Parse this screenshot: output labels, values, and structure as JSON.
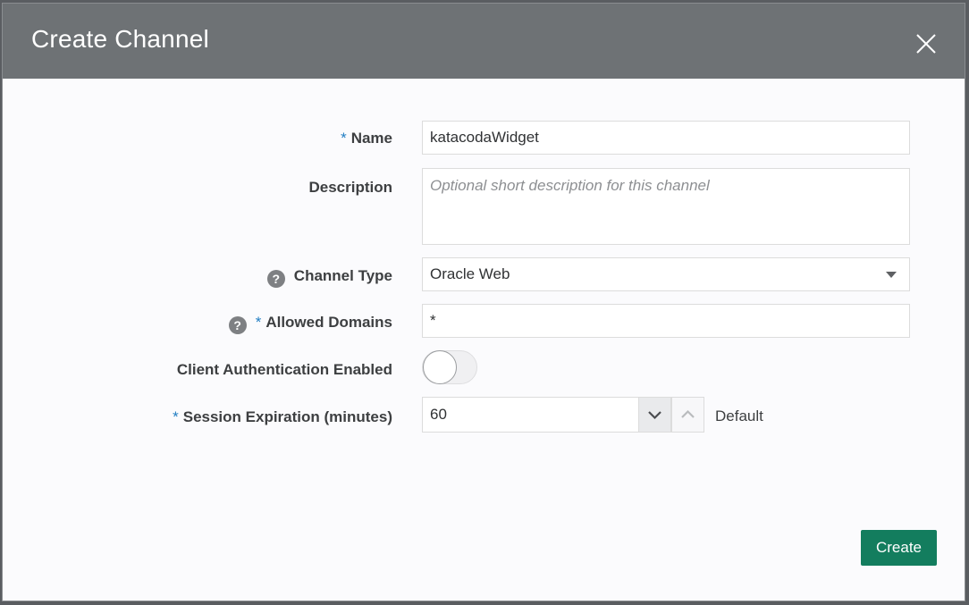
{
  "dialog": {
    "title": "Create Channel",
    "close_icon": "close-icon"
  },
  "form": {
    "name": {
      "required_mark": "*",
      "label": "Name",
      "value": "katacodaWidget"
    },
    "description": {
      "label": "Description",
      "value": "",
      "placeholder": "Optional short description for this channel"
    },
    "channel_type": {
      "help_icon": "?",
      "label": "Channel Type",
      "value": "Oracle Web"
    },
    "allowed_domains": {
      "help_icon": "?",
      "required_mark": "*",
      "label": "Allowed Domains",
      "value": "*"
    },
    "client_auth": {
      "label": "Client Authentication Enabled",
      "enabled": false
    },
    "session_expiration": {
      "required_mark": "*",
      "label": "Session Expiration (minutes)",
      "value": "60",
      "note": "Default"
    }
  },
  "footer": {
    "create_label": "Create"
  },
  "colors": {
    "titlebar": "#6e7275",
    "accent_required": "#227ec3",
    "create_button": "#137d5e"
  }
}
